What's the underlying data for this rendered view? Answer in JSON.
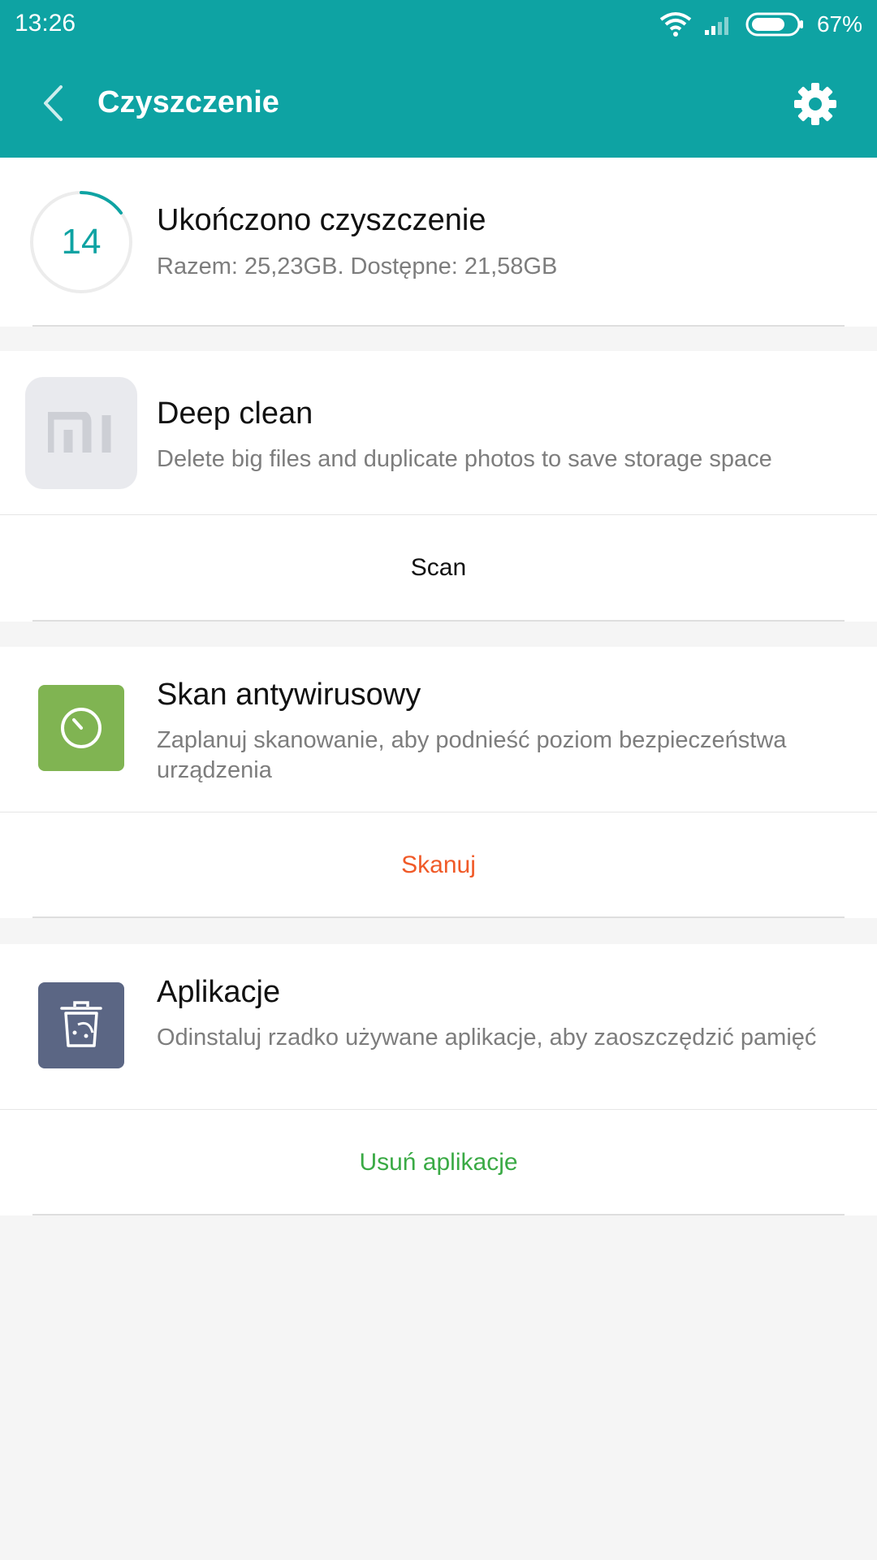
{
  "status_bar": {
    "time": "13:26",
    "battery": "67%"
  },
  "header": {
    "title": "Czyszczenie"
  },
  "summary": {
    "count": "14",
    "title": "Ukończono czyszczenie",
    "subtitle": "Razem: 25,23GB. Dostępne: 21,58GB"
  },
  "deep_clean": {
    "title": "Deep clean",
    "description": "Delete big files and duplicate photos to save storage space",
    "action": "Scan"
  },
  "antivirus": {
    "title": "Skan antywirusowy",
    "description": "Zaplanuj skanowanie, aby podnieść poziom bezpieczeństwa urządzenia",
    "action": "Skanuj"
  },
  "apps": {
    "title": "Aplikacje",
    "description": "Odinstaluj rzadko używane aplikacje, aby zaoszczędzić pamięć",
    "action": "Usuń aplikacje"
  },
  "icons": {
    "back": "chevron-left-icon",
    "settings": "gear-icon",
    "deep_clean": "mi-logo-icon",
    "antivirus": "timer-icon",
    "apps": "trash-bin-icon"
  },
  "colors": {
    "accent": "#0ea3a3",
    "antivirus_action": "#f05a28",
    "apps_action": "#3aaa45",
    "antivirus_icon_bg": "#80b452",
    "apps_icon_bg": "#5b6684"
  }
}
